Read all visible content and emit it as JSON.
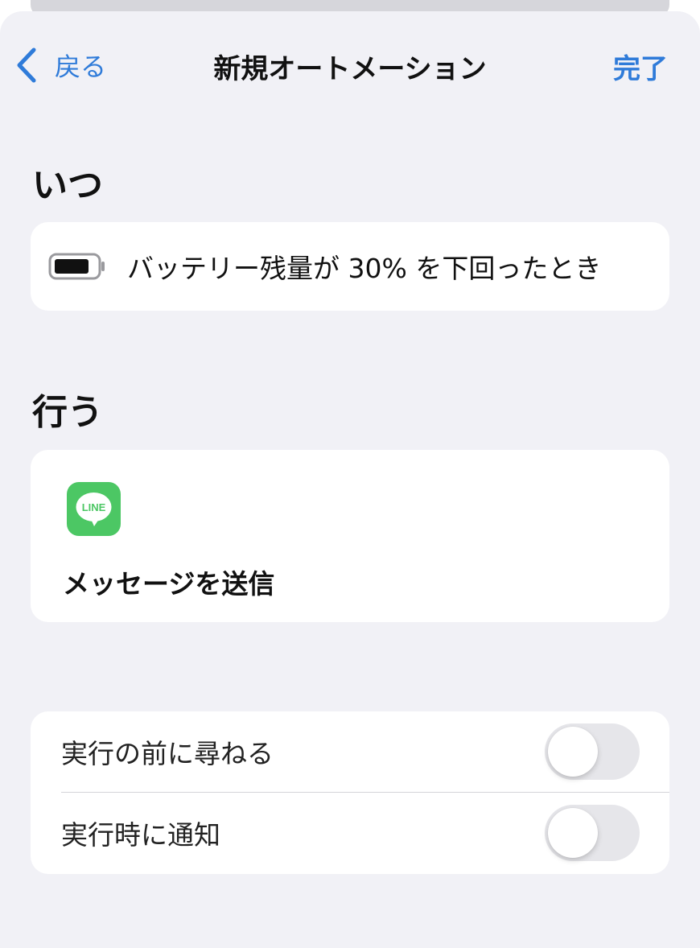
{
  "nav": {
    "back_label": "戻る",
    "title": "新規オートメーション",
    "done_label": "完了"
  },
  "when": {
    "section_title": "いつ",
    "trigger_text": "バッテリー残量が 30% を下回ったとき",
    "icon": "battery-icon"
  },
  "do": {
    "section_title": "行う",
    "app_icon": "line-app-icon",
    "app_icon_text": "LINE",
    "action_label": "メッセージを送信"
  },
  "settings": {
    "items": [
      {
        "label": "実行の前に尋ねる",
        "enabled": false
      },
      {
        "label": "実行時に通知",
        "enabled": false
      }
    ]
  },
  "colors": {
    "accent": "#2f7bd9",
    "background": "#f1f1f6",
    "line_green": "#4cc764"
  }
}
